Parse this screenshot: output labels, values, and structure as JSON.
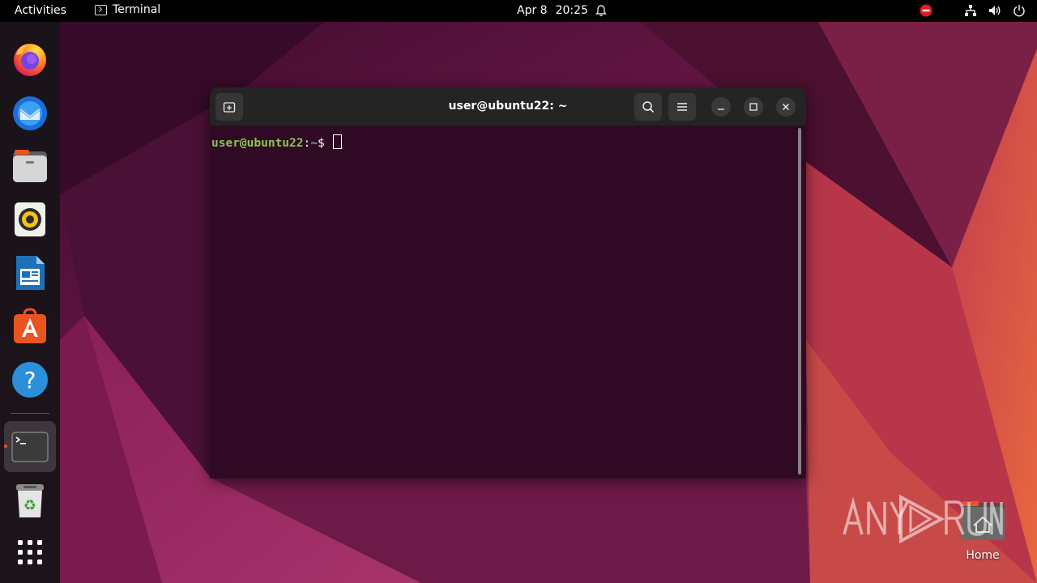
{
  "topbar": {
    "activities": "Activities",
    "app_name": "Terminal",
    "date": "Apr 8",
    "time": "20:25"
  },
  "dock": {
    "items": [
      {
        "name": "Firefox",
        "icon": "firefox-icon"
      },
      {
        "name": "Thunderbird Mail",
        "icon": "thunderbird-icon"
      },
      {
        "name": "Files",
        "icon": "files-icon"
      },
      {
        "name": "Rhythmbox",
        "icon": "rhythmbox-icon"
      },
      {
        "name": "LibreOffice Writer",
        "icon": "writer-icon"
      },
      {
        "name": "Ubuntu Software",
        "icon": "software-icon"
      },
      {
        "name": "Help",
        "icon": "help-icon"
      },
      {
        "name": "Terminal",
        "icon": "terminal-icon",
        "active": true
      },
      {
        "name": "Trash",
        "icon": "trash-icon"
      },
      {
        "name": "Show Applications",
        "icon": "app-grid-icon"
      }
    ]
  },
  "terminal": {
    "title": "user@ubuntu22: ~",
    "prompt_user": "user@ubuntu22",
    "prompt_sep": ":",
    "prompt_path": "~",
    "prompt_symbol": "$"
  },
  "desktop": {
    "home_label": "Home",
    "watermark": "ANY RUN"
  },
  "colors": {
    "accent": "#e95420",
    "terminal_bg": "#300a24",
    "prompt_green": "#87c54f",
    "prompt_blue": "#729fcf"
  }
}
